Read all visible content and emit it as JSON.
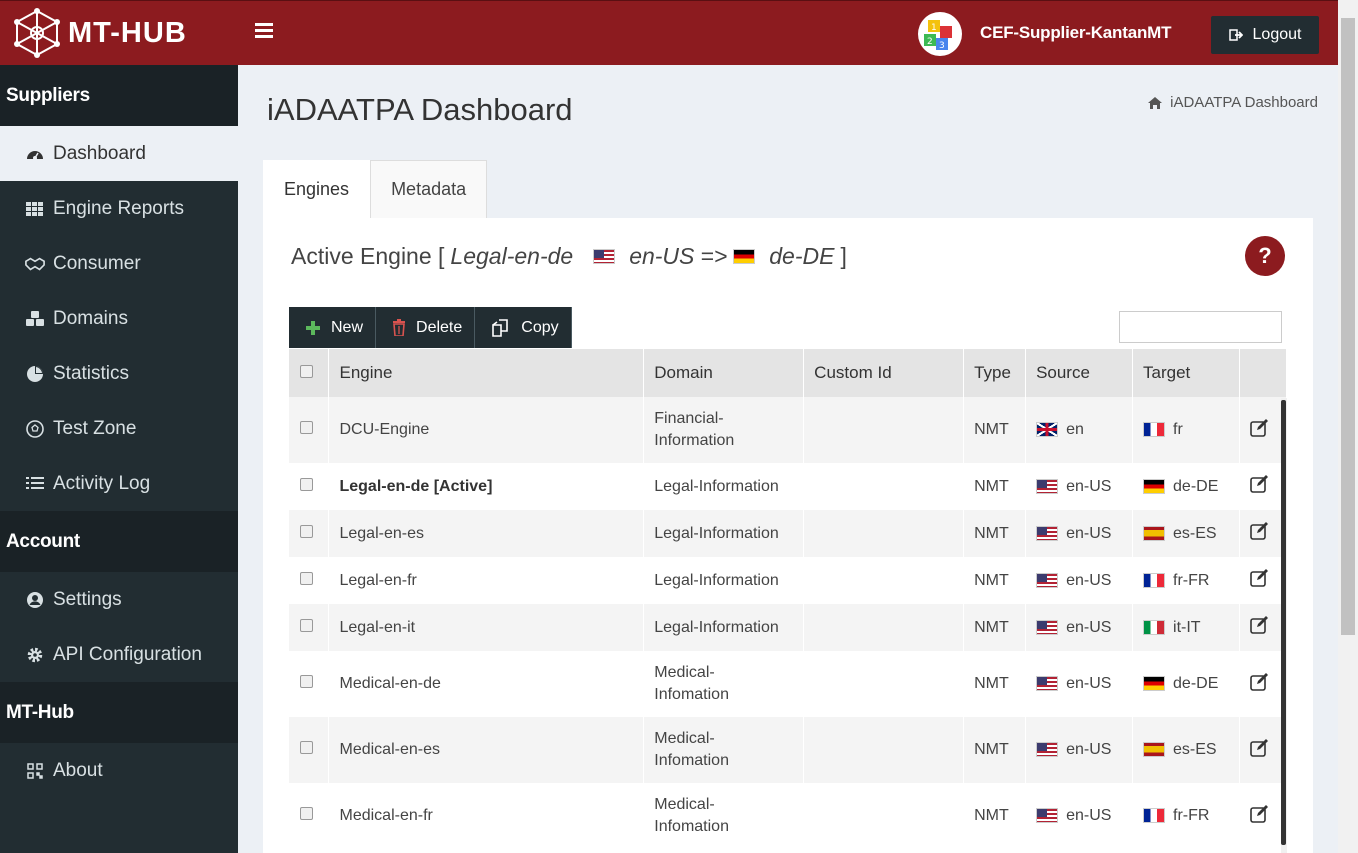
{
  "app": {
    "logo_text": "MT-HUB",
    "user_name": "CEF-Supplier-KantanMT",
    "logout_label": "Logout"
  },
  "sidebar": {
    "suppliers_header": "Suppliers",
    "suppliers_items": [
      {
        "label": "Dashboard",
        "icon": "dashboard-icon",
        "active": true
      },
      {
        "label": "Engine Reports",
        "icon": "grid-icon"
      },
      {
        "label": "Consumer",
        "icon": "handshake-icon"
      },
      {
        "label": "Domains",
        "icon": "cubes-icon"
      },
      {
        "label": "Statistics",
        "icon": "pie-chart-icon"
      },
      {
        "label": "Test Zone",
        "icon": "soccer-ball-icon"
      },
      {
        "label": "Activity Log",
        "icon": "list-icon"
      }
    ],
    "account_header": "Account",
    "account_items": [
      {
        "label": "Settings",
        "icon": "user-circle-icon"
      },
      {
        "label": "API Configuration",
        "icon": "gear-icon"
      }
    ],
    "mthub_header": "MT-Hub",
    "mthub_items": [
      {
        "label": "About",
        "icon": "qrcode-icon"
      }
    ]
  },
  "page": {
    "title": "iADAATPA Dashboard",
    "breadcrumb": "iADAATPA Dashboard"
  },
  "tabs": [
    {
      "label": "Engines",
      "active": true
    },
    {
      "label": "Metadata"
    }
  ],
  "active_engine": {
    "prefix": "Active Engine [",
    "name": "Legal-en-de",
    "source": "en-US",
    "arrow": "=>",
    "target": "de-DE",
    "suffix": "]"
  },
  "help_label": "?",
  "toolbar": {
    "new_label": "New",
    "delete_label": "Delete",
    "copy_label": "Copy"
  },
  "table": {
    "headers": [
      "Engine",
      "Domain",
      "Custom Id",
      "Type",
      "Source",
      "Target"
    ],
    "rows": [
      {
        "engine": "DCU-Engine",
        "domain_l1": "Financial-",
        "domain_l2": "Information",
        "custom_id": "",
        "type": "NMT",
        "source": "en",
        "source_flag": "gb",
        "target": "fr",
        "target_flag": "fr",
        "tall": true
      },
      {
        "engine": "Legal-en-de [Active]",
        "domain_l1": "Legal-Information",
        "domain_l2": "",
        "custom_id": "",
        "type": "NMT",
        "source": "en-US",
        "source_flag": "us",
        "target": "de-DE",
        "target_flag": "de",
        "bold": true
      },
      {
        "engine": "Legal-en-es",
        "domain_l1": "Legal-Information",
        "domain_l2": "",
        "custom_id": "",
        "type": "NMT",
        "source": "en-US",
        "source_flag": "us",
        "target": "es-ES",
        "target_flag": "es"
      },
      {
        "engine": "Legal-en-fr",
        "domain_l1": "Legal-Information",
        "domain_l2": "",
        "custom_id": "",
        "type": "NMT",
        "source": "en-US",
        "source_flag": "us",
        "target": "fr-FR",
        "target_flag": "fr"
      },
      {
        "engine": "Legal-en-it",
        "domain_l1": "Legal-Information",
        "domain_l2": "",
        "custom_id": "",
        "type": "NMT",
        "source": "en-US",
        "source_flag": "us",
        "target": "it-IT",
        "target_flag": "it"
      },
      {
        "engine": "Medical-en-de",
        "domain_l1": "Medical-",
        "domain_l2": "Infomation",
        "custom_id": "",
        "type": "NMT",
        "source": "en-US",
        "source_flag": "us",
        "target": "de-DE",
        "target_flag": "de",
        "tall": true
      },
      {
        "engine": "Medical-en-es",
        "domain_l1": "Medical-",
        "domain_l2": "Infomation",
        "custom_id": "",
        "type": "NMT",
        "source": "en-US",
        "source_flag": "us",
        "target": "es-ES",
        "target_flag": "es",
        "tall": true
      },
      {
        "engine": "Medical-en-fr",
        "domain_l1": "Medical-",
        "domain_l2": "Infomation",
        "custom_id": "",
        "type": "NMT",
        "source": "en-US",
        "source_flag": "us",
        "target": "fr-FR",
        "target_flag": "fr",
        "tall": true
      }
    ]
  }
}
